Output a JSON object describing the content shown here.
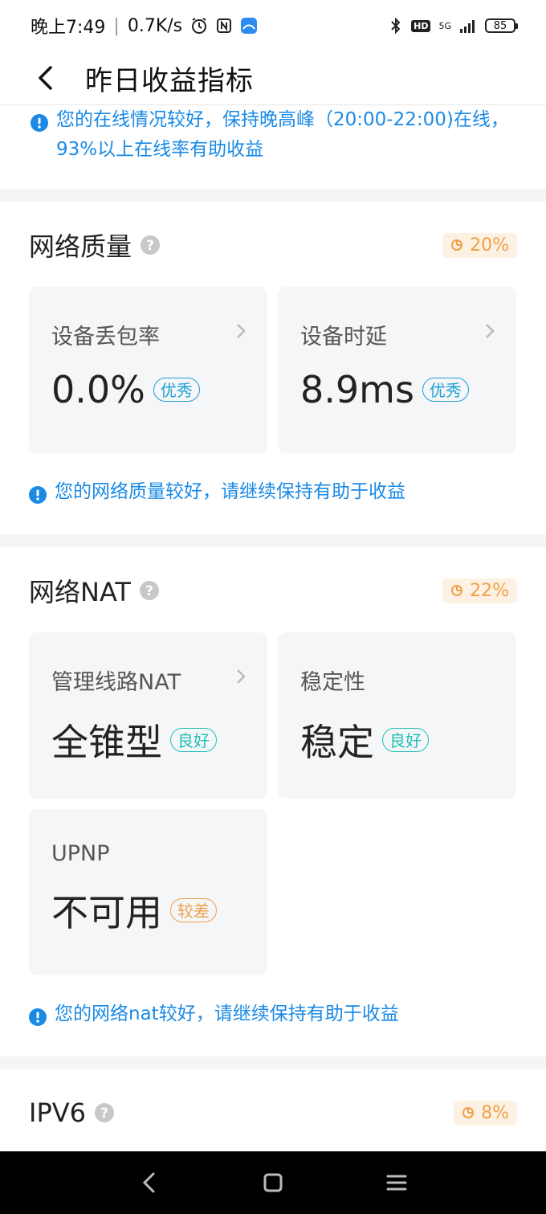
{
  "statusbar": {
    "time": "晚上7:49",
    "speed": "0.7K/s",
    "network": "5G",
    "hd": "HD",
    "battery": "85"
  },
  "appbar": {
    "title": "昨日收益指标"
  },
  "top_tip": "您的在线情况较好，保持晚高峰（20:00-22:00)在线，93%以上在线率有助收益",
  "network_quality": {
    "title": "网络质量",
    "weight": "20%",
    "cards": [
      {
        "label": "设备丢包率",
        "value": "0.0%",
        "badge": "优秀"
      },
      {
        "label": "设备时延",
        "value": "8.9ms",
        "badge": "优秀"
      }
    ],
    "tip": "您的网络质量较好，请继续保持有助于收益"
  },
  "network_nat": {
    "title": "网络NAT",
    "weight": "22%",
    "cards": [
      {
        "label": "管理线路NAT",
        "value": "全锥型",
        "badge": "良好"
      },
      {
        "label": "稳定性",
        "value": "稳定",
        "badge": "良好"
      },
      {
        "label": "UPNP",
        "value": "不可用",
        "badge": "较差"
      }
    ],
    "tip": "您的网络nat较好，请继续保持有助于收益"
  },
  "ipv6": {
    "title": "IPV6",
    "weight": "8%"
  },
  "colors": {
    "accent": "#1a8ae6",
    "good": "#1ec0b5",
    "bad": "#f0a048",
    "weight_bg": "#fdf1e3"
  }
}
